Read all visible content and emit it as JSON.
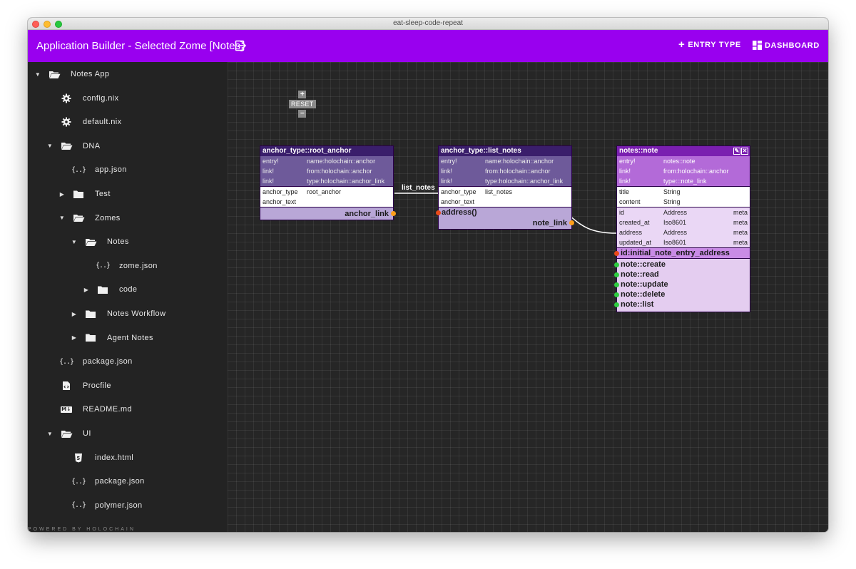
{
  "window": {
    "title": "eat-sleep-code-repeat"
  },
  "appbar": {
    "title": "Application Builder - Selected Zome [Notes]",
    "entry_type_label": "ENTRY TYPE",
    "dashboard_label": "DASHBOARD",
    "bg_color": "#9900ef"
  },
  "sidebar": {
    "items": [
      {
        "label": "Notes App",
        "icon": "folder-open-icon",
        "expanded": true
      },
      {
        "label": "config.nix",
        "icon": "gear-icon"
      },
      {
        "label": "default.nix",
        "icon": "gear-icon"
      },
      {
        "label": "DNA",
        "icon": "folder-open-icon",
        "expanded": true
      },
      {
        "label": "app.json",
        "icon": "json-braces-icon"
      },
      {
        "label": "Test",
        "icon": "folder-icon",
        "expanded": false
      },
      {
        "label": "Zomes",
        "icon": "folder-open-icon",
        "expanded": true
      },
      {
        "label": "Notes",
        "icon": "folder-open-icon",
        "expanded": true
      },
      {
        "label": "zome.json",
        "icon": "json-braces-icon"
      },
      {
        "label": "code",
        "icon": "folder-icon",
        "expanded": false
      },
      {
        "label": "Notes Workflow",
        "icon": "folder-icon",
        "expanded": false
      },
      {
        "label": "Agent Notes",
        "icon": "folder-icon",
        "expanded": false
      },
      {
        "label": "package.json",
        "icon": "json-braces-icon"
      },
      {
        "label": "Procfile",
        "icon": "code-file-icon"
      },
      {
        "label": "README.md",
        "icon": "markdown-icon"
      },
      {
        "label": "UI",
        "icon": "folder-open-icon",
        "expanded": true
      },
      {
        "label": "index.html",
        "icon": "html5-icon"
      },
      {
        "label": "package.json",
        "icon": "json-braces-icon"
      },
      {
        "label": "polymer.json",
        "icon": "json-braces-icon"
      }
    ],
    "json_glyph": "{..}",
    "md_glyph": "M↓",
    "powered_by": "POWERED BY HOLOCHAIN"
  },
  "canvas": {
    "zoom_in": "+",
    "reset": "RESET",
    "zoom_out": "−",
    "edge_label": "list_notes",
    "nodes": {
      "root_anchor": {
        "title": "anchor_type::root_anchor",
        "meta": [
          {
            "k": "entry!",
            "v": "name:holochain::anchor"
          },
          {
            "k": "link!",
            "v": "from:holochain::anchor"
          },
          {
            "k": "link!",
            "v": "type:holochain::anchor_link"
          }
        ],
        "fields": [
          {
            "k": "anchor_type",
            "v": "root_anchor"
          },
          {
            "k": "anchor_text",
            "v": ""
          }
        ],
        "link": "anchor_link"
      },
      "list_notes": {
        "title": "anchor_type::list_notes",
        "meta": [
          {
            "k": "entry!",
            "v": "name:holochain::anchor"
          },
          {
            "k": "link!",
            "v": "from:holochain::anchor"
          },
          {
            "k": "link!",
            "v": "type:holochain::anchor_link"
          }
        ],
        "fields": [
          {
            "k": "anchor_type",
            "v": "list_notes"
          },
          {
            "k": "anchor_text",
            "v": ""
          }
        ],
        "fn": "address()",
        "link": "note_link"
      },
      "note": {
        "title": "notes::note",
        "meta": [
          {
            "k": "entry!",
            "v": "notes::note"
          },
          {
            "k": "link!",
            "v": "from:holochain::anchor"
          },
          {
            "k": "link!",
            "v": "type:::note_link"
          }
        ],
        "fields": [
          {
            "k": "title",
            "v": "String"
          },
          {
            "k": "content",
            "v": "String"
          }
        ],
        "meta_fields": [
          {
            "k": "id",
            "v": "Address",
            "m": "meta"
          },
          {
            "k": "created_at",
            "v": "Iso8601",
            "m": "meta"
          },
          {
            "k": "address",
            "v": "Address",
            "m": "meta"
          },
          {
            "k": "updated_at",
            "v": "Iso8601",
            "m": "meta"
          }
        ],
        "init": "id:initial_note_entry_address",
        "fns": [
          "note::create",
          "note::read",
          "note::update",
          "note::delete",
          "note::list"
        ]
      }
    }
  }
}
